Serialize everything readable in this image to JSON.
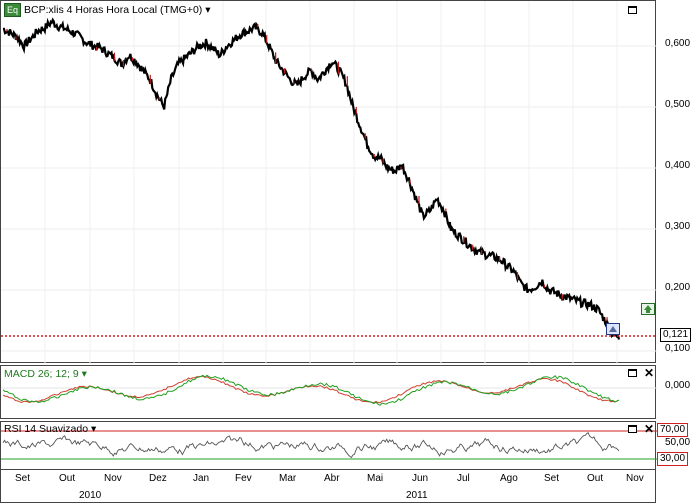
{
  "price_pane": {
    "badge": "Eq",
    "title": "BCP:xlis 4 Horas Hora Local (TMG+0)",
    "menu_glyph": "▾",
    "y_ticks": [
      "0,600",
      "0,500",
      "0,400",
      "0,300",
      "0,200",
      "0,100"
    ],
    "last_value": "0,121",
    "series": [
      0.628,
      0.622,
      0.615,
      0.6,
      0.612,
      0.625,
      0.63,
      0.64,
      0.632,
      0.628,
      0.622,
      0.615,
      0.605,
      0.6,
      0.596,
      0.588,
      0.58,
      0.57,
      0.585,
      0.575,
      0.56,
      0.545,
      0.52,
      0.5,
      0.545,
      0.57,
      0.58,
      0.59,
      0.6,
      0.605,
      0.596,
      0.585,
      0.6,
      0.61,
      0.62,
      0.625,
      0.63,
      0.622,
      0.6,
      0.575,
      0.56,
      0.545,
      0.535,
      0.55,
      0.56,
      0.545,
      0.56,
      0.575,
      0.56,
      0.54,
      0.5,
      0.47,
      0.44,
      0.42,
      0.415,
      0.4,
      0.395,
      0.405,
      0.38,
      0.35,
      0.32,
      0.33,
      0.35,
      0.33,
      0.3,
      0.29,
      0.28,
      0.27,
      0.262,
      0.258,
      0.255,
      0.25,
      0.24,
      0.23,
      0.21,
      0.2,
      0.205,
      0.215,
      0.2,
      0.195,
      0.19,
      0.186,
      0.182,
      0.178,
      0.175,
      0.168,
      0.15,
      0.13,
      0.121
    ]
  },
  "macd_pane": {
    "label": "MACD 26; 12; 9",
    "menu_glyph": "▾",
    "y_ticks": [
      "0,000"
    ],
    "close_glyph": "✕"
  },
  "rsi_pane": {
    "label": "RSI 14 Suavizado",
    "menu_glyph": "▾",
    "y_ticks": [
      "50,00"
    ],
    "upper_level": "70,00",
    "lower_level": "30,00",
    "close_glyph": "✕"
  },
  "x_axis": {
    "months": [
      "Set",
      "Out",
      "Nov",
      "Dez",
      "Jan",
      "Fev",
      "Mar",
      "Abr",
      "Mai",
      "Jun",
      "Jul",
      "Ago",
      "Set",
      "Out",
      "Nov"
    ],
    "years": [
      "2010",
      "2011"
    ]
  },
  "colors": {
    "price_line": "#000000",
    "price_down": "#c01818",
    "macd_line": "#20a020",
    "signal_line": "#d04030",
    "rsi_line": "#555555",
    "level_70": "#d02020",
    "level_30": "#20a020",
    "last_price_dotted": "#d02020"
  }
}
